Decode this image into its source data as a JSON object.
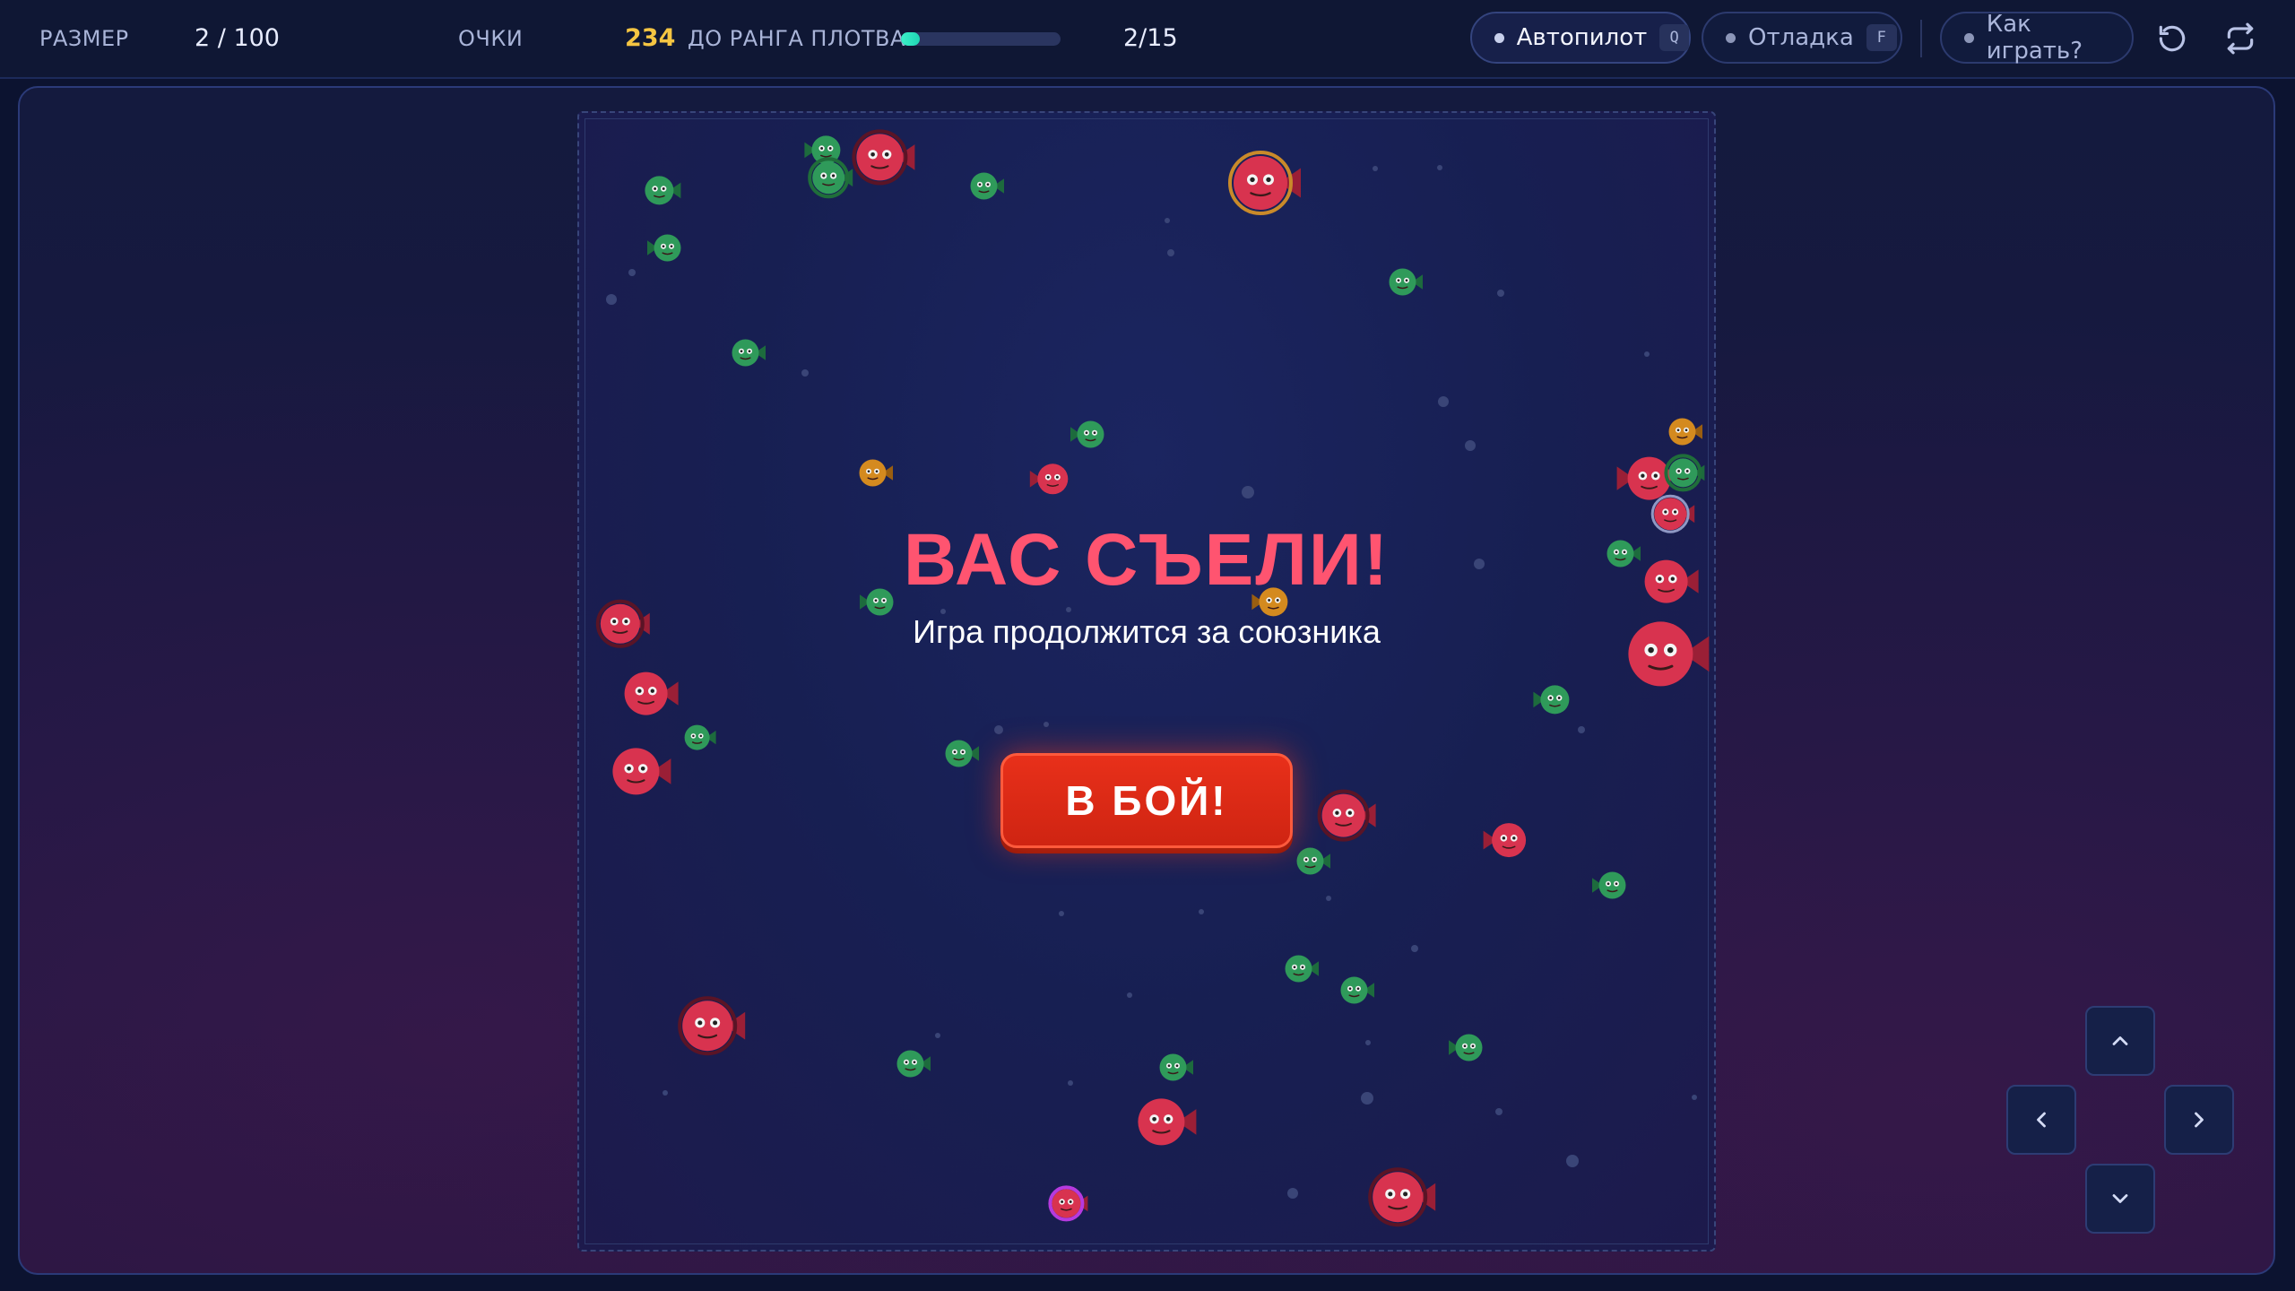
{
  "topbar": {
    "size_label": "РАЗМЕР",
    "size_value": "2 / 100",
    "score_label": "ОЧКИ",
    "score_value": "234",
    "rank_label": "ДО РАНГА ПЛОТВА",
    "rank_progress": 0.12,
    "rank_value": "2/15",
    "autopilot_label": "Автопилот",
    "autopilot_key": "Q",
    "debug_label": "Отладка",
    "debug_key": "F",
    "help_label": "Как играть?",
    "restart_icon": "restart-icon",
    "swap_icon": "swap-icon"
  },
  "overlay": {
    "title": "ВАС СЪЕЛИ!",
    "subtitle": "Игра продолжится за союзника",
    "button_label": "В БОЙ!"
  },
  "colors": {
    "ally": "#2f9a5a",
    "enemy": "#d8334f",
    "neutral": "#d48a1f",
    "title": "#ff5470",
    "button": "#dd2a16",
    "progress": "#3cf0c8"
  },
  "dpad": {
    "up_icon": "chevron-up-icon",
    "left_icon": "chevron-left-icon",
    "right_icon": "chevron-right-icon",
    "down_icon": "chevron-down-icon"
  }
}
